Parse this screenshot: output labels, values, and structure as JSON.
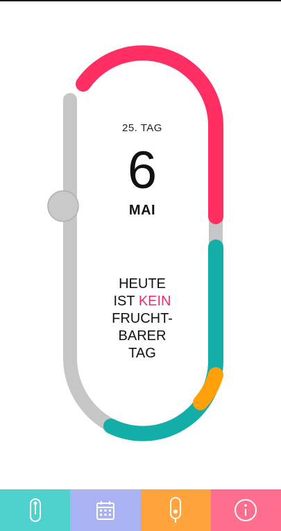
{
  "cycle": {
    "day_label": "25. TAG",
    "date_number": "6",
    "month": "MAI",
    "message_parts": {
      "line1": "HEUTE",
      "line2_prefix": "IST",
      "line2_accent": "KEIN",
      "line3": "FRUCHT-",
      "line4": "BARER",
      "line5": "TAG"
    }
  },
  "colors": {
    "track_gray": "#c6c6c6",
    "period_red": "#ff2e63",
    "fertile_teal": "#14aea8",
    "ovulation_orange": "#ffa00b",
    "accent_pink": "#e8316a"
  },
  "tabs": [
    {
      "name": "tab-cycle",
      "icon": "thermometer-icon",
      "color": "#4fd1cd"
    },
    {
      "name": "tab-calendar",
      "icon": "calendar-icon",
      "color": "#a9b2f2"
    },
    {
      "name": "tab-tampon",
      "icon": "tampon-icon",
      "color": "#ffa33d"
    },
    {
      "name": "tab-info",
      "icon": "info-icon",
      "color": "#ff6d8f"
    }
  ]
}
